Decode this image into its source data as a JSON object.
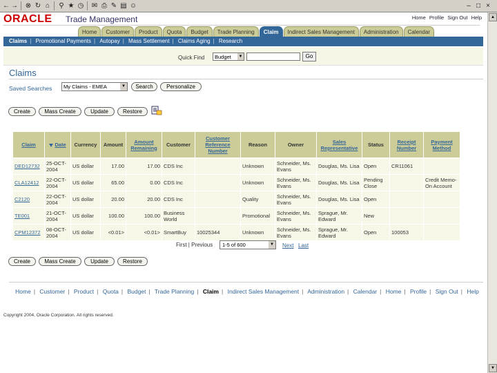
{
  "browser": {
    "toolbar_icons": [
      "back-icon",
      "forward-icon",
      "stop-icon",
      "refresh-icon",
      "home-icon",
      "search-icon",
      "favorites-icon",
      "history-icon",
      "mail-icon",
      "print-icon",
      "edit-icon",
      "discuss-icon",
      "messenger-icon"
    ],
    "window_controls": [
      "minimize-icon",
      "maximize-icon",
      "close-icon"
    ]
  },
  "header": {
    "oracle": "ORACLE",
    "product": "Trade Management",
    "global_links": [
      "Home",
      "Profile",
      "Sign Out",
      "Help"
    ]
  },
  "tabs": [
    {
      "label": "Home",
      "active": false
    },
    {
      "label": "Customer",
      "active": false
    },
    {
      "label": "Product",
      "active": false
    },
    {
      "label": "Quota",
      "active": false
    },
    {
      "label": "Budget",
      "active": false
    },
    {
      "label": "Trade Planning",
      "active": false
    },
    {
      "label": "Claim",
      "active": true
    },
    {
      "label": "Indirect Sales Management",
      "active": false
    },
    {
      "label": "Administration",
      "active": false
    },
    {
      "label": "Calendar",
      "active": false
    }
  ],
  "subtabs": [
    {
      "label": "Claims",
      "active": true
    },
    {
      "label": "Promotional Payments",
      "active": false
    },
    {
      "label": "Autopay",
      "active": false
    },
    {
      "label": "Mass Settlement",
      "active": false
    },
    {
      "label": "Claims Aging",
      "active": false
    },
    {
      "label": "Research",
      "active": false
    }
  ],
  "quick_find": {
    "label": "Quick Find",
    "selected": "Budget",
    "value": "",
    "go": "Go"
  },
  "page": {
    "title": "Claims",
    "saved_searches_label": "Saved Searches",
    "saved_search_value": "My Claims - EMEA",
    "search_button": "Search",
    "personalize_button": "Personalize"
  },
  "actions": {
    "create": "Create",
    "mass_create": "Mass Create",
    "update": "Update",
    "restore": "Restore"
  },
  "table": {
    "columns": [
      "Claim",
      "Date",
      "Currency",
      "Amount",
      "Amount Remaining",
      "Customer",
      "Customer Reference Number",
      "Reason",
      "Owner",
      "Sales Representative",
      "Status",
      "Receipt Number",
      "Payment Method"
    ],
    "rows": [
      {
        "claim": "DED12732",
        "date": "25-OCT-2004",
        "currency": "US dollar",
        "amount": "17.00",
        "remaining": "17.00",
        "customer": "CDS Inc",
        "ref": "",
        "reason": "Unknown",
        "owner": "Schneider, Ms. Evans",
        "rep": "Douglas, Ms. Lisa",
        "status": "Open",
        "receipt": "CR11061",
        "payment": ""
      },
      {
        "claim": "CLA12412",
        "date": "22-OCT-2004",
        "currency": "US dollar",
        "amount": "65.00",
        "remaining": "0.00",
        "customer": "CDS Inc",
        "ref": "",
        "reason": "Unknown",
        "owner": "Schneider, Ms. Evans",
        "rep": "Douglas, Ms. Lisa",
        "status": "Pending Close",
        "receipt": "",
        "payment": "Credit Memo-On Account"
      },
      {
        "claim": "C2120",
        "date": "22-OCT-2004",
        "currency": "US dollar",
        "amount": "20.00",
        "remaining": "20.00",
        "customer": "CDS Inc",
        "ref": "",
        "reason": "Quality",
        "owner": "Schneider, Ms. Evans",
        "rep": "Douglas, Ms. Lisa",
        "status": "Open",
        "receipt": "",
        "payment": ""
      },
      {
        "claim": "TE001",
        "date": "21-OCT-2004",
        "currency": "US dollar",
        "amount": "100.00",
        "remaining": "100.00",
        "customer": "Business World",
        "ref": "",
        "reason": "Promotional",
        "owner": "Schneider, Ms. Evans",
        "rep": "Sprague, Mr. Edward",
        "status": "New",
        "receipt": "",
        "payment": ""
      },
      {
        "claim": "CPM12372",
        "date": "08-OCT-2004",
        "currency": "US dollar",
        "amount": "<0.01>",
        "remaining": "<0.01>",
        "customer": "SmartBuy",
        "ref": "10025344",
        "reason": "Unknown",
        "owner": "Schneider, Ms. Evans",
        "rep": "Sprague, Mr. Edward",
        "status": "Open",
        "receipt": "100053",
        "payment": ""
      }
    ]
  },
  "pager": {
    "first": "First",
    "previous": "Previous",
    "range": "1-5 of 600",
    "next": "Next",
    "last": "Last"
  },
  "footer": {
    "links": [
      "Home",
      "Customer",
      "Product",
      "Quota",
      "Budget",
      "Trade Planning",
      "Claim",
      "Indirect Sales Management",
      "Administration",
      "Calendar",
      "Home",
      "Profile",
      "Sign Out",
      "Help"
    ],
    "copyright": "Copyright 2004, Oracle Corporation. All rights reserved."
  }
}
